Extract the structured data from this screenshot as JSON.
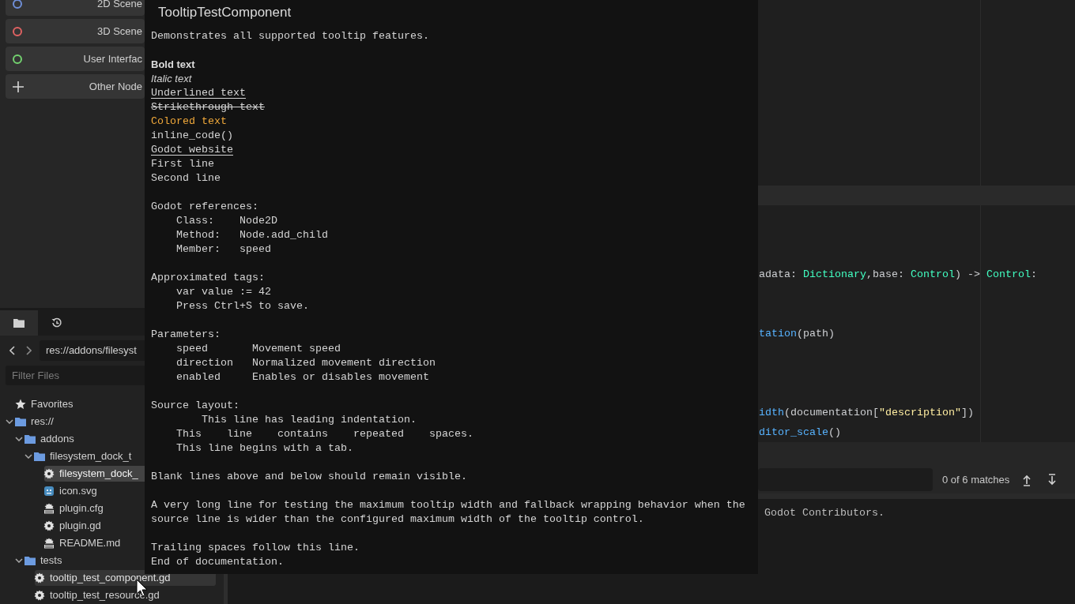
{
  "scene_buttons": [
    {
      "kind": "scene",
      "label": "2D Scene",
      "color": "#6f8fd8"
    },
    {
      "kind": "scene",
      "label": "3D Scene",
      "color": "#e06262"
    },
    {
      "kind": "scene",
      "label": "User Interfac",
      "color": "#73d36f"
    },
    {
      "kind": "other",
      "label": "Other Node"
    }
  ],
  "filesystem": {
    "tabs": [
      {
        "kind": "files",
        "selected": true
      },
      {
        "kind": "history",
        "selected": false
      }
    ],
    "path": "res://addons/filesyst",
    "filter": {
      "placeholder": "Filter Files"
    },
    "tree": [
      {
        "kind": "star",
        "label": "Favorites",
        "selected": false,
        "hovered": false
      },
      {
        "kind": "folder",
        "label": "res://",
        "expanded": true,
        "selected": false,
        "hovered": false,
        "children": [
          {
            "kind": "folder",
            "label": "addons",
            "expanded": true,
            "selected": false,
            "hovered": false,
            "children": [
              {
                "kind": "folder",
                "label": "filesystem_dock_t",
                "expanded": true,
                "selected": false,
                "hovered": false,
                "children": [
                  {
                    "kind": "script",
                    "label": "filesystem_dock_",
                    "selected": true,
                    "hovered": false
                  },
                  {
                    "kind": "image",
                    "label": "icon.svg",
                    "selected": false,
                    "hovered": false
                  },
                  {
                    "kind": "text",
                    "label": "plugin.cfg",
                    "selected": false,
                    "hovered": false
                  },
                  {
                    "kind": "script",
                    "label": "plugin.gd",
                    "selected": false,
                    "hovered": false
                  },
                  {
                    "kind": "text",
                    "label": "README.md",
                    "selected": false,
                    "hovered": false
                  }
                ]
              }
            ]
          },
          {
            "kind": "folder",
            "label": "tests",
            "expanded": true,
            "selected": false,
            "hovered": false,
            "children": [
              {
                "kind": "script",
                "label": "tooltip_test_component.gd",
                "selected": false,
                "hovered": true
              },
              {
                "kind": "script",
                "label": "tooltip_test_resource.gd",
                "selected": false,
                "hovered": false
              }
            ]
          }
        ]
      }
    ]
  },
  "editor": {
    "code_lines": [
      {
        "kind": "current_line"
      },
      {
        "kind": "blank"
      },
      {
        "kind": "blank"
      },
      {
        "kind": "blank"
      },
      {
        "kind": "code",
        "tokens": [
          {
            "kind": "plain",
            "text": "adata: "
          },
          {
            "kind": "type",
            "text": "Dictionary"
          },
          {
            "kind": "plain",
            "text": ",base: "
          },
          {
            "kind": "type",
            "text": "Control"
          },
          {
            "kind": "plain",
            "text": ") -> "
          },
          {
            "kind": "type",
            "text": "Control"
          },
          {
            "kind": "plain",
            "text": ":"
          }
        ]
      },
      {
        "kind": "blank"
      },
      {
        "kind": "blank"
      },
      {
        "kind": "code",
        "tokens": [
          {
            "kind": "func",
            "text": "tation"
          },
          {
            "kind": "plain",
            "text": "(path)"
          }
        ]
      },
      {
        "kind": "blank"
      },
      {
        "kind": "blank"
      },
      {
        "kind": "blank"
      },
      {
        "kind": "code",
        "tokens": [
          {
            "kind": "func",
            "text": "idth"
          },
          {
            "kind": "plain",
            "text": "(documentation["
          },
          {
            "kind": "string",
            "text": "\"description\""
          },
          {
            "kind": "plain",
            "text": "])"
          }
        ]
      },
      {
        "kind": "code",
        "tokens": [
          {
            "kind": "func",
            "text": "ditor_scale"
          },
          {
            "kind": "plain",
            "text": "()"
          }
        ]
      }
    ],
    "find": {
      "matches": "0 of 6 matches"
    },
    "output": [
      "Godot Contributors."
    ]
  },
  "tooltip": {
    "title": "TooltipTestComponent",
    "blocks": [
      [
        {
          "kind": "plain",
          "text": "Demonstrates all supported tooltip features."
        }
      ],
      [
        {
          "kind": "bold",
          "text": "Bold text"
        },
        {
          "kind": "italic",
          "text": "Italic text"
        },
        {
          "kind": "underline",
          "text": "Underlined text"
        },
        {
          "kind": "strike",
          "text": "Strikethrough text"
        },
        {
          "kind": "colored",
          "text": "Colored text",
          "color": "#f0a83a"
        },
        {
          "kind": "code",
          "text": "inline_code()"
        },
        {
          "kind": "link",
          "text": "Godot website"
        },
        {
          "kind": "plain",
          "text": "First line"
        },
        {
          "kind": "plain",
          "text": "Second line"
        }
      ],
      [
        {
          "kind": "plain",
          "text": "Godot references:"
        },
        {
          "kind": "plain",
          "text": "    Class:    Node2D"
        },
        {
          "kind": "plain",
          "text": "    Method:   Node.add_child"
        },
        {
          "kind": "plain",
          "text": "    Member:   speed"
        }
      ],
      [
        {
          "kind": "plain",
          "text": "Approximated tags:"
        },
        {
          "kind": "code",
          "text": "    var value := 42"
        },
        {
          "kind": "plain",
          "text": "    Press Ctrl+S to save."
        }
      ],
      [
        {
          "kind": "plain",
          "text": "Parameters:"
        },
        {
          "kind": "plain",
          "text": "    speed       Movement speed"
        },
        {
          "kind": "plain",
          "text": "    direction   Normalized movement direction"
        },
        {
          "kind": "plain",
          "text": "    enabled     Enables or disables movement"
        }
      ],
      [
        {
          "kind": "plain",
          "text": "Source layout:"
        },
        {
          "kind": "plain",
          "text": "        This line has leading indentation."
        },
        {
          "kind": "plain",
          "text": "    This    line    contains    repeated    spaces."
        },
        {
          "kind": "plain",
          "text": "    This line begins with a tab."
        }
      ],
      [
        {
          "kind": "plain",
          "text": "Blank lines above and below should remain visible."
        }
      ],
      [
        {
          "kind": "plain",
          "text": "A very long line for testing the maximum tooltip width and fallback wrapping behavior when the source line is wider than the configured maximum width of the tooltip control."
        }
      ],
      [
        {
          "kind": "plain",
          "text": "Trailing spaces follow this line."
        },
        {
          "kind": "plain",
          "text": "End of documentation."
        }
      ]
    ]
  }
}
